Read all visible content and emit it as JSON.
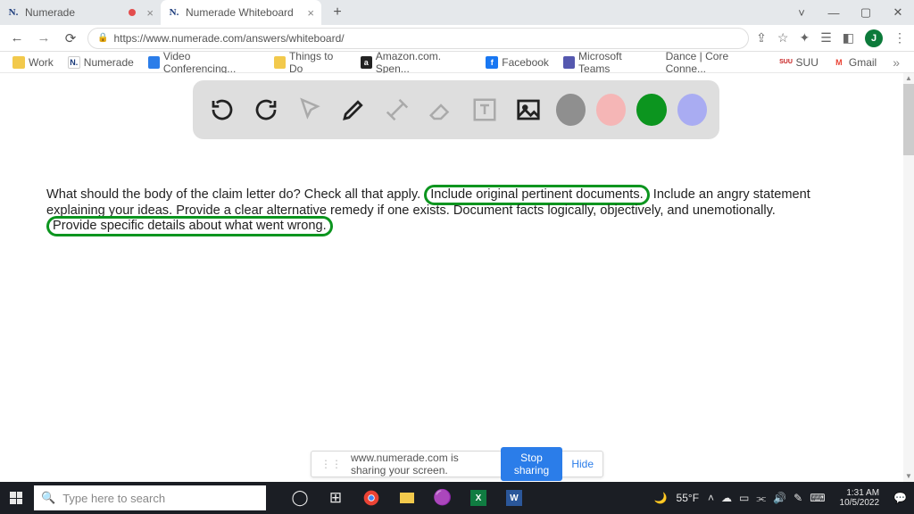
{
  "tabs": [
    {
      "label": "Numerade",
      "favicon": "N."
    },
    {
      "label": "Numerade Whiteboard",
      "favicon": "N."
    }
  ],
  "url": "https://www.numerade.com/answers/whiteboard/",
  "avatar_letter": "J",
  "bookmarks": [
    {
      "label": "Work",
      "color": "#f2c94c"
    },
    {
      "label": "Numerade",
      "color": "#1a3a7a",
      "text": "N."
    },
    {
      "label": "Video Conferencing...",
      "color": "#2b7de9"
    },
    {
      "label": "Things to Do",
      "color": "#f2c94c"
    },
    {
      "label": "Amazon.com. Spen...",
      "color": "#222",
      "text": "a"
    },
    {
      "label": "Facebook",
      "color": "#1877f2",
      "text": "f"
    },
    {
      "label": "Microsoft Teams",
      "color": "#5558af"
    },
    {
      "label": "Dance | Core Conne..."
    },
    {
      "label": "SUU",
      "color": "#c61a1a",
      "text": "SUU"
    },
    {
      "label": "Gmail",
      "color": "#ea4335",
      "text": "M"
    }
  ],
  "toolbar": {
    "swatches": [
      "#8f8f8f",
      "#f5b6b6",
      "#0c951f",
      "#a9acf2"
    ]
  },
  "question": {
    "intro": "What should the body of the claim letter do? Check all that apply. ",
    "hl1": "Include original pertinent documents.",
    "mid1": " Include an angry statement explaining your ideas. Provide a clear alternative remedy if one exists. Document facts logically, objectively, and unemotionally. ",
    "hl2": "Provide specific details about what went wrong."
  },
  "share": {
    "text": "www.numerade.com is sharing your screen.",
    "stop": "Stop sharing",
    "hide": "Hide"
  },
  "taskbar": {
    "search_placeholder": "Type here to search",
    "temp": "55°F",
    "time": "1:31 AM",
    "date": "10/5/2022"
  }
}
